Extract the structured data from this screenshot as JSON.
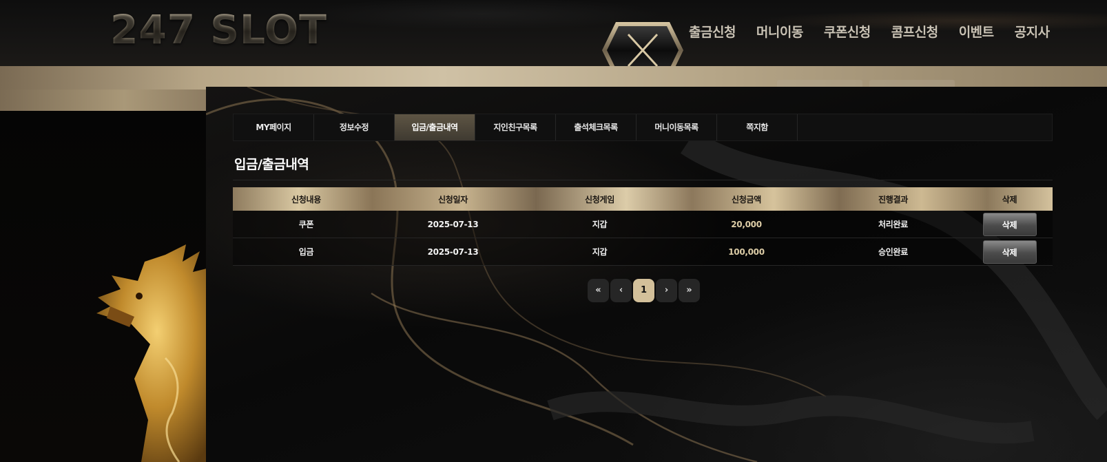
{
  "header": {
    "logo": "247 SLOT",
    "nav_fragment": "|",
    "nav": [
      "출금신청",
      "머니이동",
      "쿠폰신청",
      "콤프신청",
      "이벤트",
      "공지사"
    ]
  },
  "mypage": {
    "tabs": [
      {
        "label": "MY페이지",
        "active": false
      },
      {
        "label": "정보수정",
        "active": false
      },
      {
        "label": "입금/출금내역",
        "active": true
      },
      {
        "label": "지인친구목록",
        "active": false
      },
      {
        "label": "출석체크목록",
        "active": false
      },
      {
        "label": "머니이동목록",
        "active": false
      },
      {
        "label": "쪽지함",
        "active": false
      }
    ],
    "title": "입금/출금내역",
    "table": {
      "headers": [
        "신청내용",
        "신청일자",
        "신청게임",
        "신청금액",
        "진행결과",
        "삭제"
      ],
      "rows": [
        {
          "type": "쿠폰",
          "date": "2025-07-13",
          "game": "지갑",
          "amount": "20,000",
          "result": "처리완료",
          "delete": "삭제"
        },
        {
          "type": "입금",
          "date": "2025-07-13",
          "game": "지갑",
          "amount": "100,000",
          "result": "승인완료",
          "delete": "삭제"
        }
      ]
    },
    "pagination": {
      "first": "«",
      "prev": "‹",
      "current": "1",
      "next": "›",
      "last": "»"
    }
  },
  "colors": {
    "gold_accent": "#d3c09a",
    "panel_bg": "#0b0b0b"
  }
}
